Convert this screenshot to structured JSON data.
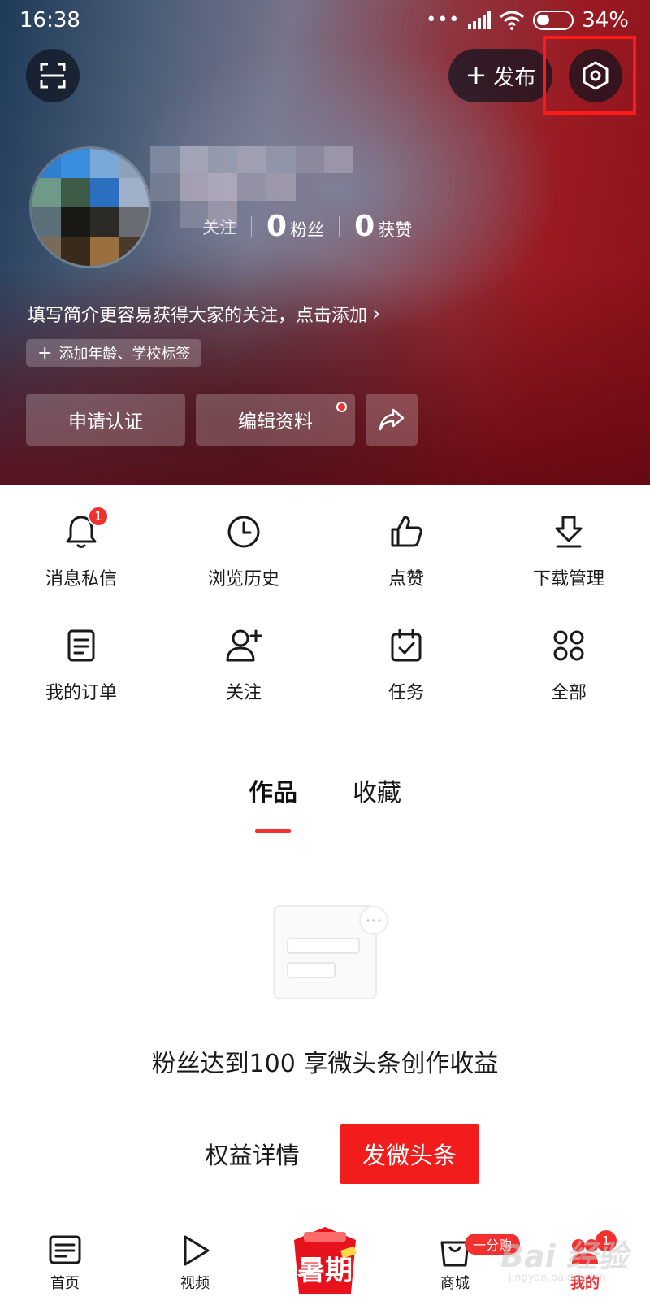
{
  "status_bar": {
    "time": "16:38",
    "dots": "•••",
    "battery": "34%"
  },
  "header": {
    "publish_label": "发布",
    "stats": [
      {
        "value": "",
        "label": "关注"
      },
      {
        "value": "0",
        "label": "粉丝"
      },
      {
        "value": "0",
        "label": "获赞"
      }
    ],
    "bio_prompt": "填写简介更容易获得大家的关注，点击添加",
    "tag_chip": "添加年龄、学校标签",
    "buttons": {
      "certify": "申请认证",
      "edit_profile": "编辑资料"
    },
    "highlight_color": "#ff1a1a"
  },
  "menu": {
    "items": [
      {
        "label": "消息私信",
        "icon": "bell-icon",
        "badge": "1"
      },
      {
        "label": "浏览历史",
        "icon": "clock-icon"
      },
      {
        "label": "点赞",
        "icon": "thumbs-up-icon"
      },
      {
        "label": "下载管理",
        "icon": "download-icon"
      },
      {
        "label": "我的订单",
        "icon": "order-list-icon"
      },
      {
        "label": "关注",
        "icon": "add-follow-icon"
      },
      {
        "label": "任务",
        "icon": "calendar-check-icon"
      },
      {
        "label": "全部",
        "icon": "grid-circles-icon"
      }
    ]
  },
  "tabs": [
    {
      "label": "作品",
      "active": true
    },
    {
      "label": "收藏",
      "active": false
    }
  ],
  "empty_state": {
    "message": "粉丝达到100 享微头条创作收益",
    "benefits_button": "权益详情",
    "post_button": "发微头条"
  },
  "bottom_nav": {
    "items": [
      {
        "label": "首页",
        "icon": "home-list-icon"
      },
      {
        "label": "视频",
        "icon": "play-icon"
      },
      {
        "label": "商城",
        "icon": "shopping-bag-icon"
      },
      {
        "label": "我的",
        "icon": "profile-icon",
        "active": true
      }
    ],
    "promo": "暑期",
    "mall_flag": "一分购",
    "profile_count": "1"
  },
  "watermark": {
    "main": "Bai 经验",
    "sub": "jingyan.baidu.com"
  },
  "colors": {
    "accent": "#f23030",
    "primary_button": "#f21c1c",
    "text": "#1a1a1a"
  }
}
